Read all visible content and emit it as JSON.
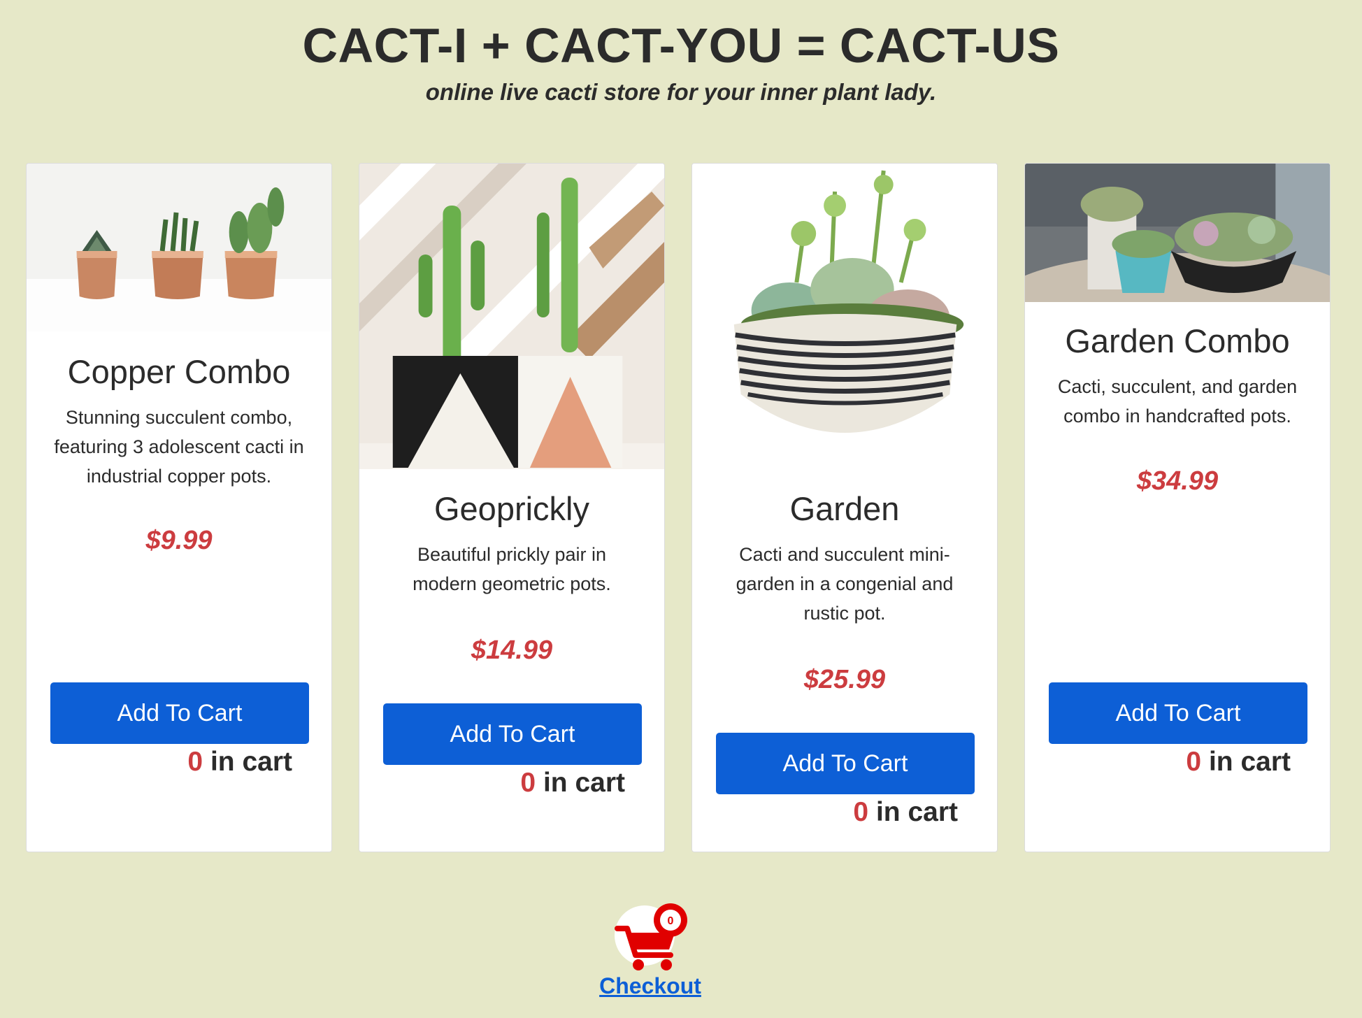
{
  "header": {
    "title": "CACT-I + CACT-YOU = CACT-US",
    "subtitle": "online live cacti store for your inner plant lady."
  },
  "products": [
    {
      "name": "Copper Combo",
      "description": "Stunning succulent combo, featuring 3 adolescent cacti in industrial copper pots.",
      "price": "$9.99",
      "button_label": "Add To Cart",
      "cart_count": "0",
      "cart_suffix": " in cart"
    },
    {
      "name": "Geoprickly",
      "description": "Beautiful prickly pair in modern geometric pots.",
      "price": "$14.99",
      "button_label": "Add To Cart",
      "cart_count": "0",
      "cart_suffix": " in cart"
    },
    {
      "name": "Garden",
      "description": "Cacti and succulent mini-garden in a congenial and rustic pot.",
      "price": "$25.99",
      "button_label": "Add To Cart",
      "cart_count": "0",
      "cart_suffix": " in cart"
    },
    {
      "name": "Garden Combo",
      "description": "Cacti, succulent, and garden combo in handcrafted pots.",
      "price": "$34.99",
      "button_label": "Add To Cart",
      "cart_count": "0",
      "cart_suffix": " in cart"
    }
  ],
  "checkout": {
    "badge_count": "0",
    "link_label": "Checkout"
  },
  "colors": {
    "background": "#e6e8c8",
    "button": "#0d5fd6",
    "price": "#cc3c3f",
    "cart_icon": "#e00000"
  }
}
